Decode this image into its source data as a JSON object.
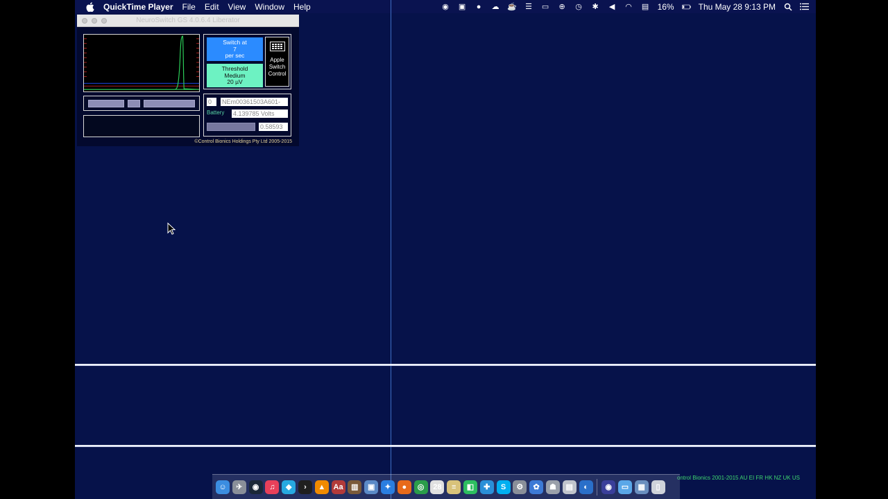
{
  "menubar": {
    "app_name": "QuickTime Player",
    "menus": [
      "File",
      "Edit",
      "View",
      "Window",
      "Help"
    ],
    "battery_percent": "16%",
    "datetime": "Thu May 28  9:13 PM",
    "status_icons": [
      "record-icon",
      "lock-icon",
      "pin-icon",
      "cloud-icon",
      "cup-icon",
      "keyboard-icon",
      "airplay-icon",
      "accessibility-icon",
      "time-machine-icon",
      "bluetooth-icon",
      "volume-icon",
      "wifi-icon",
      "input-icon",
      "battery-icon",
      "spotlight-icon",
      "notification-center-icon"
    ]
  },
  "window": {
    "title": "NeuroSwitch GS 4.0.6.4 Liberator",
    "switch_button": {
      "line1": "Switch at",
      "line2": "7",
      "line3": "per sec"
    },
    "threshold_button": {
      "line1": "Threshold",
      "line2": "Medium",
      "line3": "20 µV"
    },
    "apple_switch": {
      "line1": "Apple",
      "line2": "Switch",
      "line3": "Control"
    },
    "index_field": "0",
    "device_id": "NEm00361503A601-",
    "battery_label": "Battery",
    "volts_field": "4.139785 Volts",
    "battery_level": 0.58593,
    "value_field": "0.58593",
    "copyright": "©Control Bionics Holdings Pty Ltd 2005-2015"
  },
  "background_text": "ontrol Bionics 2001-2015 AU EI FR HK NZ UK US",
  "dock": {
    "items": [
      {
        "name": "finder-icon",
        "glyph": "☺",
        "color": "#3b8de0"
      },
      {
        "name": "launchpad-icon",
        "glyph": "✈",
        "color": "#8a8f99"
      },
      {
        "name": "steam-icon",
        "glyph": "◉",
        "color": "#1b2838"
      },
      {
        "name": "itunes-icon",
        "glyph": "♫",
        "color": "#e8405a"
      },
      {
        "name": "kodi-icon",
        "glyph": "◆",
        "color": "#27a9e1"
      },
      {
        "name": "plex-icon",
        "glyph": "›",
        "color": "#1f1f1f"
      },
      {
        "name": "vlc-icon",
        "glyph": "▲",
        "color": "#f08a00"
      },
      {
        "name": "dictionary-icon",
        "glyph": "Aa",
        "color": "#b23a3a"
      },
      {
        "name": "ibooks-icon",
        "glyph": "▥",
        "color": "#7a5a3a"
      },
      {
        "name": "preview-icon",
        "glyph": "▣",
        "color": "#5b8ac7"
      },
      {
        "name": "safari-icon",
        "glyph": "✦",
        "color": "#2a7ee0"
      },
      {
        "name": "firefox-icon",
        "glyph": "●",
        "color": "#e86a1a"
      },
      {
        "name": "chrome-icon",
        "glyph": "◎",
        "color": "#2a9d4a"
      },
      {
        "name": "calendar-icon",
        "glyph": "28",
        "color": "#e0e0e0"
      },
      {
        "name": "notes-icon",
        "glyph": "≡",
        "color": "#d8c27a"
      },
      {
        "name": "evernote-icon",
        "glyph": "◧",
        "color": "#2dbe60"
      },
      {
        "name": "xcode-icon",
        "glyph": "✚",
        "color": "#2a8fd8"
      },
      {
        "name": "skype-icon",
        "glyph": "S",
        "color": "#00aff0"
      },
      {
        "name": "system-preferences-icon",
        "glyph": "⚙",
        "color": "#8a8f99"
      },
      {
        "name": "utility-icon",
        "glyph": "✿",
        "color": "#3d7ad6"
      },
      {
        "name": "automator-icon",
        "glyph": "☗",
        "color": "#9aa0aa"
      },
      {
        "name": "scanner-icon",
        "glyph": "▤",
        "color": "#c0c4cc"
      },
      {
        "name": "browser-icon",
        "glyph": "◐",
        "color": "#2a6fc9"
      }
    ],
    "right_items": [
      {
        "name": "quicktime-icon",
        "glyph": "◉",
        "color": "#3a3f9a"
      },
      {
        "name": "downloads-folder-icon",
        "glyph": "▭",
        "color": "#5aa7e8"
      },
      {
        "name": "applications-folder-icon",
        "glyph": "▦",
        "color": "#6a8fbf"
      },
      {
        "name": "trash-icon",
        "glyph": "▯",
        "color": "#cfd3da"
      }
    ]
  }
}
